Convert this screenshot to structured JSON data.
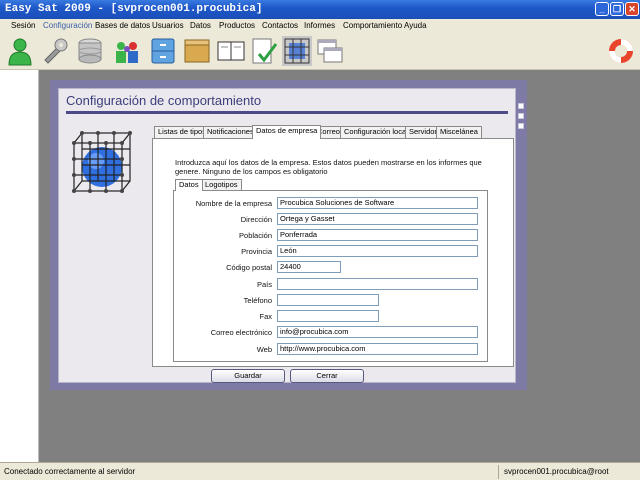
{
  "window": {
    "title": "Easy Sat 2009 - [svprocen001.procubica]"
  },
  "menu": [
    "Sesión",
    "Configuración",
    "Bases de datos",
    "Usuarios",
    "Datos",
    "Productos",
    "Contactos",
    "Informes",
    "Comportamiento",
    "Ayuda"
  ],
  "toolbar": {
    "icons": [
      "user-green-icon",
      "wrench-icon",
      "database-icon",
      "users-group-icon",
      "cabinet-icon",
      "box-icon",
      "book-icon",
      "checklist-icon",
      "cube-grid-icon",
      "windows-icon",
      "lifebuoy-icon"
    ]
  },
  "dialog": {
    "title": "Configuración de comportamiento",
    "tabs": [
      "Listas de tipos",
      "Notificaciones",
      "Datos de empresa",
      "Correo",
      "Configuración local",
      "Servidor",
      "Miscelánea"
    ],
    "active_tab": "Datos de empresa",
    "intro": "Introduzca aquí los datos de la empresa. Estos datos pueden mostrarse en los informes que genere. Ninguno de los campos es obligatorio",
    "subtabs": [
      "Datos",
      "Logotipos"
    ],
    "fields": [
      {
        "label": "Nombre de la empresa",
        "value": "Procubica Soluciones de Software"
      },
      {
        "label": "Dirección",
        "value": "Ortega y Gasset"
      },
      {
        "label": "Población",
        "value": "Ponferrada"
      },
      {
        "label": "Provincia",
        "value": "León"
      },
      {
        "label": "Código postal",
        "value": "24400"
      },
      {
        "label": "País",
        "value": ""
      },
      {
        "label": "Teléfono",
        "value": ""
      },
      {
        "label": "Fax",
        "value": ""
      },
      {
        "label": "Correo electrónico",
        "value": "info@procubica.com"
      },
      {
        "label": "Web",
        "value": "http://www.procubica.com"
      }
    ],
    "save_label": "Guardar",
    "close_label": "Cerrar"
  },
  "status": {
    "left": "Conectado correctamente al servidor",
    "right": "svprocen001.procubica@root"
  },
  "colors": {
    "accent": "#4E4A8A",
    "dialog_frame": "#7E7AA6",
    "title_text": "#3B3E7A"
  }
}
